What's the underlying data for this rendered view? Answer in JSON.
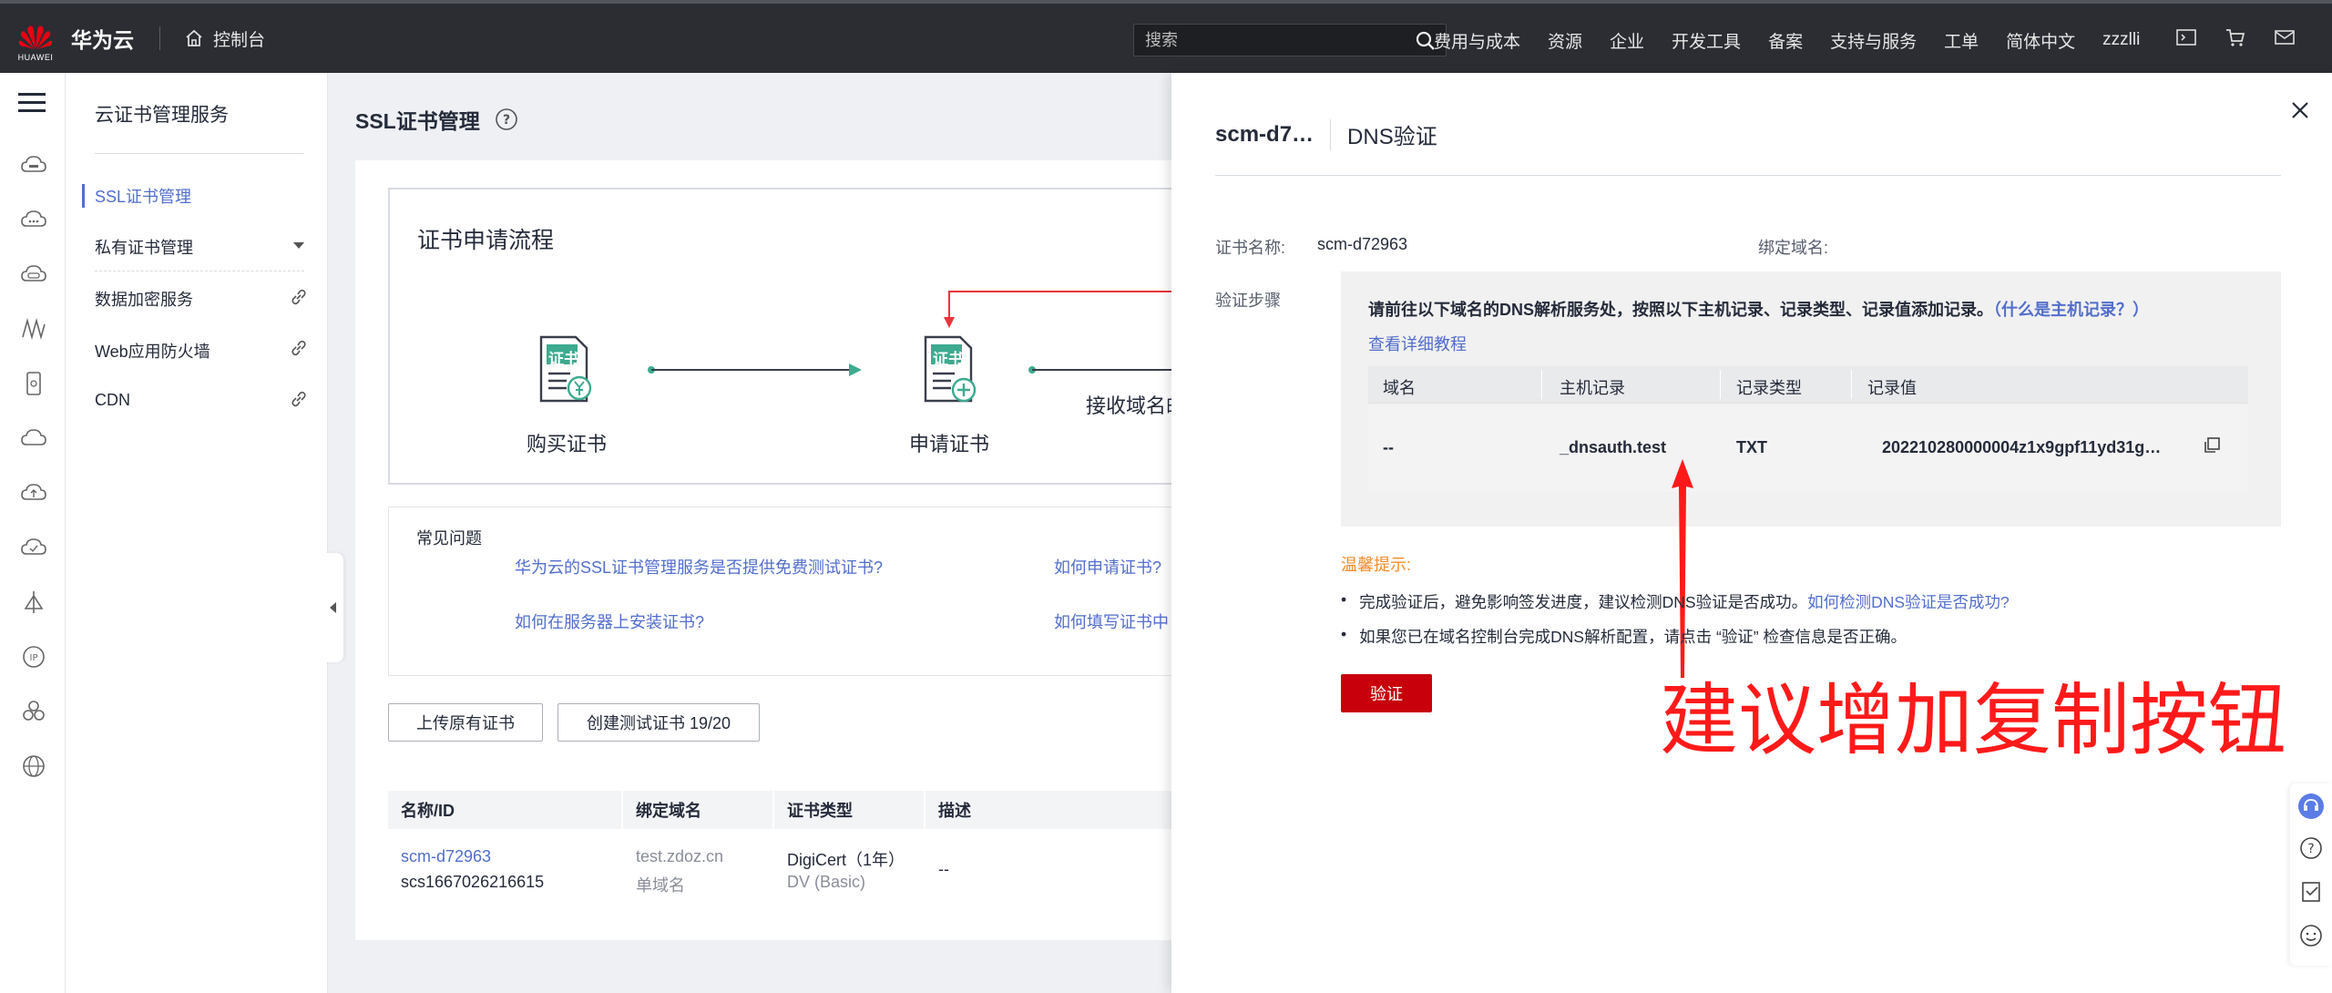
{
  "topbar": {
    "brand": "HUAWEI",
    "logo_text": "华为云",
    "console": "控制台",
    "search_placeholder": "搜索",
    "nav": [
      "费用与成本",
      "资源",
      "企业",
      "开发工具",
      "备案",
      "支持与服务",
      "工单",
      "简体中文",
      "zzzlli"
    ],
    "icons": [
      "terminal-icon",
      "cart-icon",
      "mail-icon"
    ]
  },
  "service": {
    "title": "云证书管理服务",
    "items": [
      {
        "label": "SSL证书管理",
        "active": true
      },
      {
        "label": "私有证书管理"
      },
      {
        "label": "数据加密服务"
      },
      {
        "label": "Web应用防火墙"
      },
      {
        "label": "CDN"
      }
    ]
  },
  "main": {
    "title": "SSL证书管理",
    "flow_title": "证书申请流程",
    "steps": [
      "购买证书",
      "申请证书",
      "接收域名邮"
    ],
    "step_badge": "证书",
    "faq_title": "常见问题",
    "faq": [
      "华为云的SSL证书管理服务是否提供免费测试证书?",
      "如何申请证书?",
      "如何在服务器上安装证书?",
      "如何填写证书中"
    ],
    "buttons": {
      "upload": "上传原有证书",
      "create_test": "创建测试证书 19/20"
    },
    "table": {
      "headers": [
        "名称/ID",
        "绑定域名",
        "证书类型",
        "描述"
      ],
      "row": {
        "name": "scm-d72963",
        "id": "scs1667026216615",
        "domain": "test.zdoz.cn",
        "domain_type": "单域名",
        "cert_type": "DigiCert（1年）",
        "cert_level": "DV (Basic)",
        "desc": "--"
      }
    }
  },
  "drawer": {
    "cert_short": "scm-d7…",
    "title": "DNS验证",
    "cert_name_label": "证书名称:",
    "cert_name": "scm-d72963",
    "bind_domain_label": "绑定域名:",
    "steps_label": "验证步骤",
    "instruction": "请前往以下域名的DNS解析服务处，按照以下主机记录、记录类型、记录值添加记录。",
    "what_is_host": "（什么是主机记录？）",
    "tutorial_link": "查看详细教程",
    "record_headers": [
      "域名",
      "主机记录",
      "记录类型",
      "记录值"
    ],
    "record": {
      "domain": "--",
      "host": "_dnsauth.test",
      "type": "TXT",
      "value": "202210280000004z1x9gpf11yd31g…"
    },
    "tips_title": "温馨提示:",
    "tip1": "完成验证后，避免影响签发进度，建议检测DNS验证是否成功。",
    "tip1_link": "如何检测DNS验证是否成功?",
    "tip2": "如果您已在域名控制台完成DNS解析配置，请点击 “验证” 检查信息是否正确。",
    "verify_button": "验证",
    "annotation": "建议增加复制按钮"
  },
  "colors": {
    "accent": "#526ecc",
    "brand_red": "#c7000b",
    "annotation": "#ff1a1a",
    "tip_orange": "#f28c28"
  }
}
